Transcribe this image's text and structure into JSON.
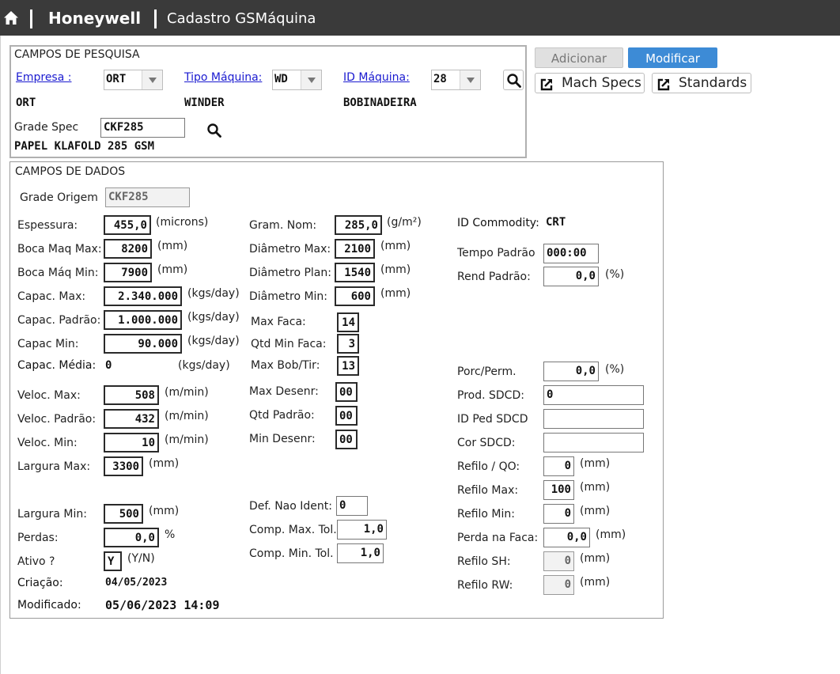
{
  "header": {
    "app_name": "Honeywell",
    "page_title": "Cadastro GSMáquina"
  },
  "actions": {
    "add_label": "Adicionar",
    "modify_label": "Modificar",
    "mach_specs_label": "Mach Specs",
    "standards_label": "Standards"
  },
  "search": {
    "title": "CAMPOS DE PESQUISA",
    "empresa": {
      "label": "Empresa :",
      "value": "ORT",
      "desc": "ORT"
    },
    "tipo_maquina": {
      "label": "Tipo Máquina:",
      "value": "WD",
      "desc": "WINDER"
    },
    "id_maquina": {
      "label": "ID Máquina:",
      "value": "28",
      "desc": "BOBINADEIRA"
    },
    "grade_spec": {
      "label": "Grade Spec",
      "value": "CKF285",
      "desc": "PAPEL KLAFOLD 285 GSM"
    }
  },
  "data": {
    "title": "CAMPOS DE DADOS",
    "grade_origem": {
      "label": "Grade Origem",
      "value": "CKF285"
    },
    "col1": {
      "espessura": {
        "label": "Espessura:",
        "value": "455,0",
        "unit": "(microns)"
      },
      "boca_maq_max": {
        "label": "Boca Maq Max:",
        "value": "8200",
        "unit": "(mm)"
      },
      "boca_maq_min": {
        "label": "Boca Máq Min:",
        "value": "7900",
        "unit": "(mm)"
      },
      "capac_max": {
        "label": "Capac. Max:",
        "value": "2.340.000",
        "unit": "(kgs/day)"
      },
      "capac_padrao": {
        "label": "Capac. Padrão:",
        "value": "1.000.000",
        "unit": "(kgs/day)"
      },
      "capac_min": {
        "label": "Capac Min:",
        "value": "90.000",
        "unit": "(kgs/day)"
      },
      "capac_media": {
        "label": "Capac. Média:",
        "value": "0",
        "unit": "(kgs/day)"
      },
      "veloc_max": {
        "label": "Veloc. Max:",
        "value": "508",
        "unit": "(m/min)"
      },
      "veloc_padrao": {
        "label": "Veloc. Padrão:",
        "value": "432",
        "unit": "(m/min)"
      },
      "veloc_min": {
        "label": "Veloc. Min:",
        "value": "10",
        "unit": "(m/min)"
      },
      "largura_max": {
        "label": "Largura Max:",
        "value": "3300",
        "unit": "(mm)"
      },
      "largura_min": {
        "label": "Largura Min:",
        "value": "500",
        "unit": "(mm)"
      },
      "perdas": {
        "label": "Perdas:",
        "value": "0,0",
        "unit": "%"
      },
      "ativo": {
        "label": "Ativo ?",
        "value": "Y",
        "unit": "(Y/N)"
      },
      "criacao": {
        "label": "Criação:",
        "value": "04/05/2023"
      },
      "modificado": {
        "label": "Modificado:",
        "value": "05/06/2023 14:09"
      }
    },
    "col2": {
      "gram_nom": {
        "label": "Gram. Nom:",
        "value": "285,0",
        "unit": "(g/m²)"
      },
      "diametro_max": {
        "label": "Diâmetro Max:",
        "value": "2100",
        "unit": "(mm)"
      },
      "diametro_plan": {
        "label": "Diâmetro Plan:",
        "value": "1540",
        "unit": "(mm)"
      },
      "diametro_min": {
        "label": "Diâmetro Min:",
        "value": "600",
        "unit": "(mm)"
      },
      "max_faca": {
        "label": "Max Faca:",
        "value": "14"
      },
      "qtd_min_faca": {
        "label": "Qtd Min Faca:",
        "value": "3"
      },
      "max_bob_tir": {
        "label": "Max Bob/Tir:",
        "value": "13"
      },
      "max_desenr": {
        "label": "Max Desenr:",
        "value": "00"
      },
      "qtd_padrao": {
        "label": "Qtd Padrão:",
        "value": "00"
      },
      "min_desenr": {
        "label": "Min Desenr:",
        "value": "00"
      },
      "def_nao_ident": {
        "label": "Def. Nao Ident:",
        "value": "0"
      },
      "comp_max_tol": {
        "label": "Comp. Max. Tol.",
        "value": "1,0"
      },
      "comp_min_tol": {
        "label": "Comp. Min. Tol.",
        "value": "1,0"
      }
    },
    "col3": {
      "id_commodity": {
        "label": "ID Commodity:",
        "value": "CRT"
      },
      "tempo_padrao": {
        "label": "Tempo Padrão",
        "value": "000:00"
      },
      "rend_padrao": {
        "label": "Rend Padrão:",
        "value": "0,0",
        "unit": "(%)"
      },
      "porc_perm": {
        "label": "Porc/Perm.",
        "value": "0,0",
        "unit": "(%)"
      },
      "prod_sdcd": {
        "label": "Prod. SDCD:",
        "value": "0"
      },
      "id_ped_sdcd": {
        "label": "ID Ped SDCD",
        "value": ""
      },
      "cor_sdcd": {
        "label": "Cor SDCD:",
        "value": ""
      },
      "refilo_qo": {
        "label": "Refilo / QO:",
        "value": "0",
        "unit": "(mm)"
      },
      "refilo_max": {
        "label": "Refilo Max:",
        "value": "100",
        "unit": "(mm)"
      },
      "refilo_min": {
        "label": "Refilo Min:",
        "value": "0",
        "unit": "(mm)"
      },
      "perda_na_faca": {
        "label": "Perda na Faca:",
        "value": "0,0",
        "unit": "(mm)"
      },
      "refilo_sh": {
        "label": "Refilo SH:",
        "value": "0",
        "unit": "(mm)"
      },
      "refilo_rw": {
        "label": "Refilo RW:",
        "value": "0",
        "unit": "(mm)"
      }
    }
  }
}
